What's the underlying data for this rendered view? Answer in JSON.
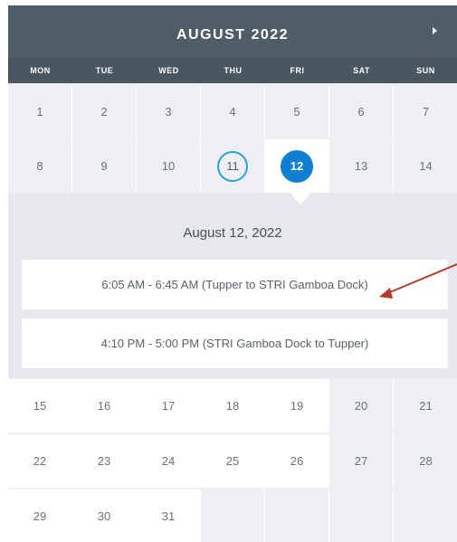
{
  "calendar": {
    "month_title": "AUGUST 2022",
    "next_icon": "chevron-right-icon",
    "weekdays": [
      "MON",
      "TUE",
      "WED",
      "THU",
      "FRI",
      "SAT",
      "SUN"
    ],
    "weeks": [
      [
        "1",
        "2",
        "3",
        "4",
        "5",
        "6",
        "7"
      ],
      [
        "8",
        "9",
        "10",
        "11",
        "12",
        "13",
        "14"
      ],
      [
        "15",
        "16",
        "17",
        "18",
        "19",
        "20",
        "21"
      ],
      [
        "22",
        "23",
        "24",
        "25",
        "26",
        "27",
        "28"
      ],
      [
        "29",
        "30",
        "31",
        "",
        "",
        "",
        ""
      ]
    ],
    "today": "11",
    "selected": "12"
  },
  "detail": {
    "date_label": "August 12, 2022",
    "slots": [
      "6:05 AM - 6:45 AM (Tupper to STRI Gamboa Dock)",
      "4:10 PM - 5:00 PM (STRI Gamboa Dock to Tupper)"
    ]
  },
  "colors": {
    "header": "#4f5d69",
    "selected": "#0f7fd0",
    "today_ring": "#2aa0d8",
    "annotation_arrow": "#b33a2e"
  }
}
